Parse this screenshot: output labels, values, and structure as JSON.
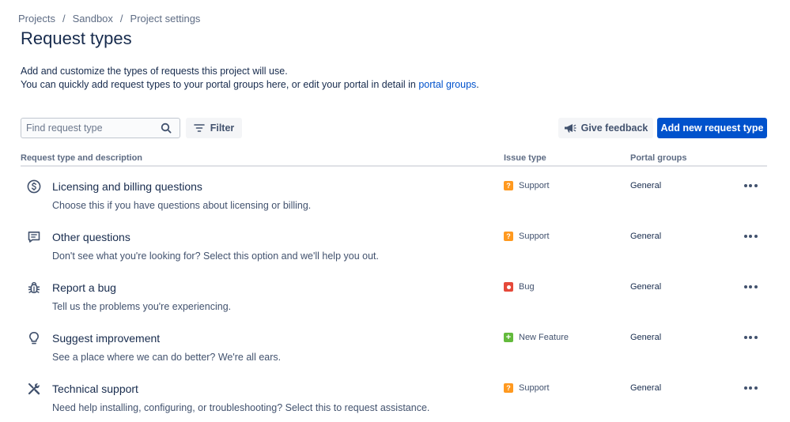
{
  "breadcrumb": [
    "Projects",
    "Sandbox",
    "Project settings"
  ],
  "page_title": "Request types",
  "description": {
    "line1": "Add and customize the types of requests this project will use.",
    "line2_prefix": "You can quickly add request types to your portal groups here, or edit your portal in detail in ",
    "line2_link": "portal groups",
    "line2_suffix": "."
  },
  "toolbar": {
    "search_placeholder": "Find request type",
    "filter_label": "Filter",
    "feedback_label": "Give feedback",
    "add_label": "Add new request type"
  },
  "table": {
    "columns": [
      "Request type and description",
      "Issue type",
      "Portal groups"
    ],
    "rows": [
      {
        "icon": "dollar-circle-icon",
        "name": "Licensing and billing questions",
        "desc": "Choose this if you have questions about licensing or billing.",
        "issue_type": "Support",
        "issue_icon": "question-badge-icon",
        "portal": "General"
      },
      {
        "icon": "comment-icon",
        "name": "Other questions",
        "desc": "Don't see what you're looking for? Select this option and we'll help you out.",
        "issue_type": "Support",
        "issue_icon": "question-badge-icon",
        "portal": "General"
      },
      {
        "icon": "bug-icon",
        "name": "Report a bug",
        "desc": "Tell us the problems you're experiencing.",
        "issue_type": "Bug",
        "issue_icon": "bug-badge-icon",
        "portal": "General"
      },
      {
        "icon": "lightbulb-icon",
        "name": "Suggest improvement",
        "desc": "See a place where we can do better? We're all ears.",
        "issue_type": "New Feature",
        "issue_icon": "plus-badge-icon",
        "portal": "General"
      },
      {
        "icon": "tools-icon",
        "name": "Technical support",
        "desc": "Need help installing, configuring, or troubleshooting? Select this to request assistance.",
        "issue_type": "Support",
        "issue_icon": "question-badge-icon",
        "portal": "General"
      }
    ]
  },
  "colors": {
    "primary": "#0052cc",
    "support_badge": "#ff991f",
    "bug_badge": "#e5493a",
    "feature_badge": "#63ba3c"
  }
}
